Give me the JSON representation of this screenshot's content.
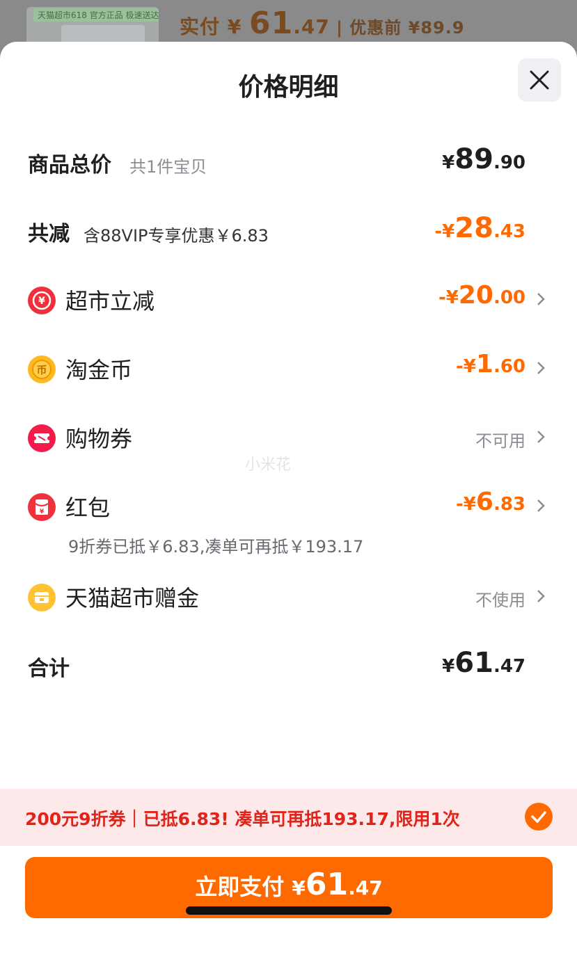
{
  "backdrop": {
    "tag": "天猫超市618 官方正品 极速送达",
    "pay_label": "实付 ¥ ",
    "pay_int": "61",
    "pay_dec": ".47",
    "orig": " | 优惠前 ¥89.9"
  },
  "sheet": {
    "title": "价格明细"
  },
  "total": {
    "label": "商品总价",
    "sub": "共1件宝贝",
    "cur": "¥",
    "int": "89",
    "dec": ".90"
  },
  "reduce": {
    "label": "共减",
    "sub": "含88VIP专享优惠￥6.83",
    "cur": "-¥",
    "int": "28",
    "dec": ".43"
  },
  "items": [
    {
      "label": "超市立减",
      "icon": "supermarket-discount-icon",
      "cur": "-¥",
      "int": "20",
      "dec": ".00"
    },
    {
      "label": "淘金币",
      "icon": "taojinbi-coin-icon",
      "cur": "-¥",
      "int": "1",
      "dec": ".60"
    },
    {
      "label": "购物券",
      "icon": "coupon-icon",
      "status": "不可用"
    },
    {
      "label": "红包",
      "icon": "red-packet-icon",
      "cur": "-¥",
      "int": "6",
      "dec": ".83"
    },
    {
      "label": "天猫超市赠金",
      "icon": "tmall-gift-money-icon",
      "status": "不使用"
    }
  ],
  "red_packet_note": "9折券已抵￥6.83,凑单可再抵￥193.17",
  "watermark": "小米花",
  "sum": {
    "label": "合计",
    "cur": "¥",
    "int": "61",
    "dec": ".47"
  },
  "promo": {
    "text": "200元9折券｜已抵6.83! 凑单可再抵193.17,限用1次"
  },
  "pay_button": {
    "label": "立即支付 ",
    "cur": "¥",
    "int": "61",
    "dec": ".47"
  },
  "colors": {
    "accent": "#ff6a00",
    "promo_bg": "#fde8ea",
    "promo_text": "#e2231a"
  }
}
